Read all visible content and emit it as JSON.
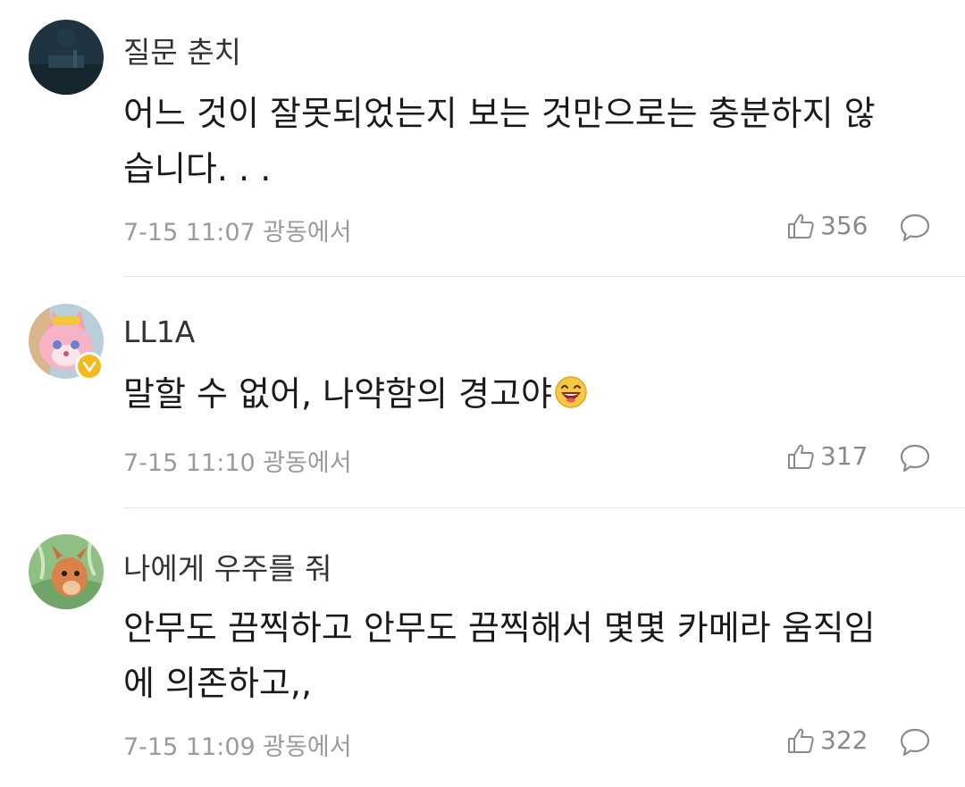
{
  "comments": [
    {
      "username": "질문 춘치",
      "text": "어느 것이 잘못되었는지 보는 것만으로는 충분하지 않\n습니다. . .",
      "meta": "7-15 11:07 광동에서",
      "likes": "356",
      "avatar_icon": "dark-scene-avatar",
      "verified": false
    },
    {
      "username": "LL1A",
      "text": "말할 수 없어, 나약함의 경고야",
      "emoji_icon": "laughing-face-emoji",
      "meta": "7-15 11:10 광동에서",
      "likes": "317",
      "avatar_icon": "pink-fox-avatar",
      "verified": true
    },
    {
      "username": "나에게 우주를 줘",
      "text": "안무도 끔찍하고 안무도 끔찍해서 몇몇 카메라 움직임\n에 의존하고,,",
      "meta": "7-15 11:09 광동에서",
      "likes": "322",
      "avatar_icon": "deer-illustration-avatar",
      "verified": false
    }
  ],
  "colors": {
    "text": "#1a1a1a",
    "username": "#333333",
    "meta": "#9a9a9a",
    "icon": "#8a8a8a",
    "divider": "#e6e6e6",
    "verified_badge": "#f5b81d"
  }
}
